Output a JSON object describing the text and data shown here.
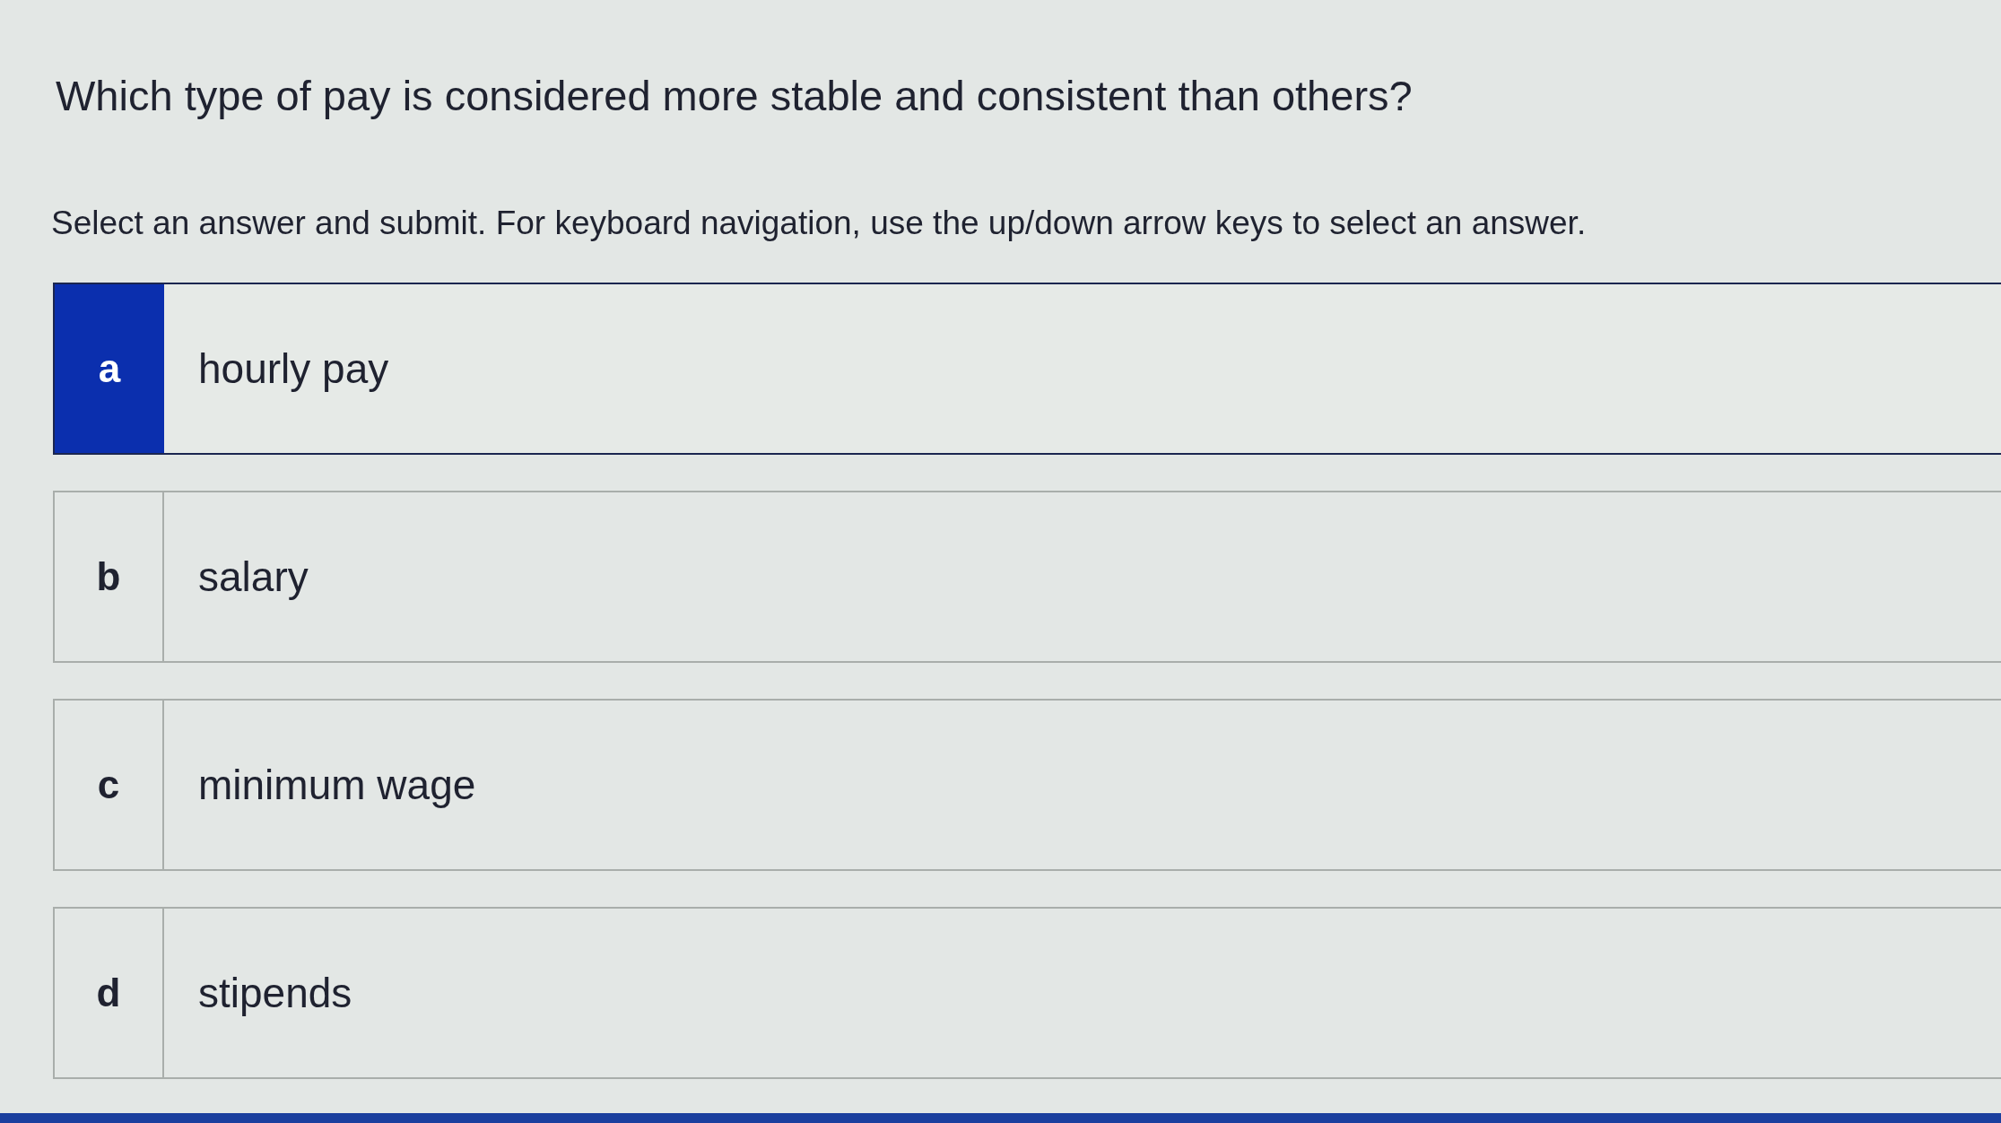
{
  "question": "Which type of pay is considered more stable and consistent than others?",
  "instructions": "Select an answer and submit. For keyboard navigation, use the up/down arrow keys to select an answer.",
  "options": [
    {
      "letter": "a",
      "text": "hourly pay",
      "selected": true
    },
    {
      "letter": "b",
      "text": "salary",
      "selected": false
    },
    {
      "letter": "c",
      "text": "minimum wage",
      "selected": false
    },
    {
      "letter": "d",
      "text": "stipends",
      "selected": false
    }
  ]
}
